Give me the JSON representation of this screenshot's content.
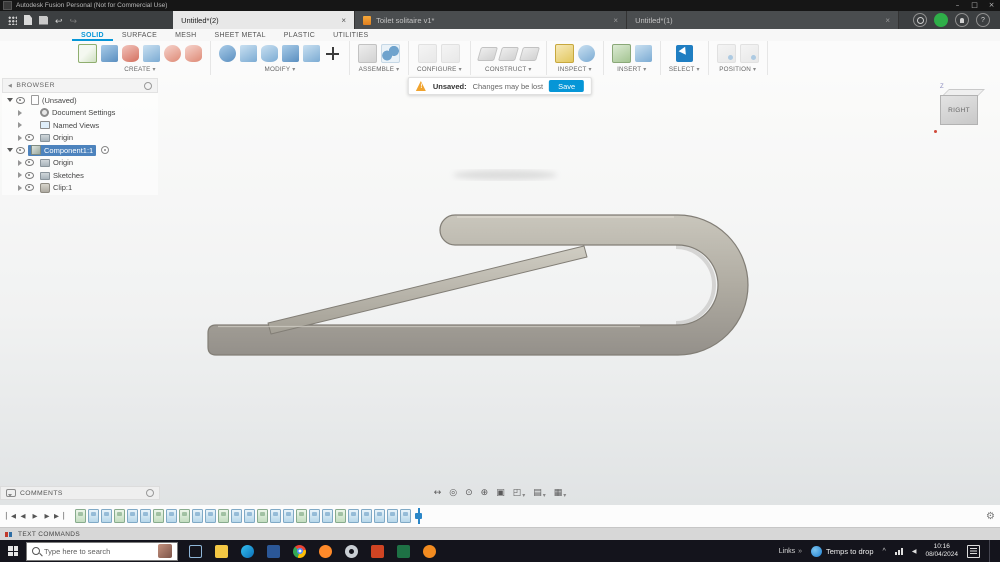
{
  "window": {
    "title": "Autodesk Fusion Personal (Not for Commercial Use)",
    "minimize": "–",
    "maximize": "□",
    "close": "×"
  },
  "doc_tabs": [
    {
      "label": "Untitled*(2)",
      "close": "×",
      "active": true
    },
    {
      "label": "Toilet solitaire v1*",
      "close": "×",
      "icon": true
    },
    {
      "label": "Untitled*(1)",
      "close": "×"
    }
  ],
  "ribbon": {
    "tabs": [
      {
        "label": "SOLID",
        "active": true
      },
      {
        "label": "SURFACE"
      },
      {
        "label": "MESH"
      },
      {
        "label": "SHEET METAL"
      },
      {
        "label": "PLASTIC"
      },
      {
        "label": "UTILITIES"
      }
    ],
    "groups": [
      {
        "label": "CREATE"
      },
      {
        "label": "MODIFY"
      },
      {
        "label": "ASSEMBLE"
      },
      {
        "label": "CONFIGURE"
      },
      {
        "label": "CONSTRUCT"
      },
      {
        "label": "INSPECT"
      },
      {
        "label": "INSERT"
      },
      {
        "label": "SELECT"
      },
      {
        "label": "POSITION"
      }
    ]
  },
  "notification": {
    "title": "Unsaved:",
    "message": "Changes may be lost",
    "action": "Save"
  },
  "browser": {
    "header": "BROWSER",
    "items": [
      {
        "label": "(Unsaved)",
        "level": 0,
        "type": "doc",
        "expanded": true,
        "eye": true
      },
      {
        "label": "Document Settings",
        "level": 1,
        "type": "gear"
      },
      {
        "label": "Named Views",
        "level": 1,
        "type": "views"
      },
      {
        "label": "Origin",
        "level": 1,
        "type": "folder",
        "eye": true
      },
      {
        "label": "Component1:1",
        "level": 0,
        "type": "component",
        "expanded": true,
        "eye": true,
        "selected": true,
        "radio": true
      },
      {
        "label": "Origin",
        "level": 1,
        "type": "folder",
        "eye": true
      },
      {
        "label": "Sketches",
        "level": 1,
        "type": "folder",
        "eye": true
      },
      {
        "label": "Clip:1",
        "level": 1,
        "type": "body",
        "eye": true
      }
    ]
  },
  "viewcube": {
    "face": "RIGHT",
    "axis": "Z"
  },
  "comments": {
    "label": "COMMENTS"
  },
  "navbar": {
    "items": [
      {
        "name": "pan-icon"
      },
      {
        "name": "orbit-icon"
      },
      {
        "name": "look-at-icon"
      },
      {
        "name": "zoom-icon"
      },
      {
        "name": "fit-icon"
      },
      {
        "name": "zoom-window-icon",
        "caret": true
      },
      {
        "name": "display-settings-icon",
        "caret": true
      },
      {
        "name": "grid-display-icon",
        "caret": true
      }
    ]
  },
  "timeline": {
    "features": [
      {
        "type": "sketch"
      },
      {
        "type": "feature"
      },
      {
        "type": "feature"
      },
      {
        "type": "sketch"
      },
      {
        "type": "feature"
      },
      {
        "type": "feature"
      },
      {
        "type": "sketch"
      },
      {
        "type": "feature"
      },
      {
        "type": "sketch"
      },
      {
        "type": "feature"
      },
      {
        "type": "feature"
      },
      {
        "type": "sketch"
      },
      {
        "type": "feature"
      },
      {
        "type": "feature"
      },
      {
        "type": "sketch"
      },
      {
        "type": "feature"
      },
      {
        "type": "feature"
      },
      {
        "type": "sketch"
      },
      {
        "type": "feature"
      },
      {
        "type": "feature"
      },
      {
        "type": "sketch"
      },
      {
        "type": "feature"
      },
      {
        "type": "feature"
      },
      {
        "type": "feature"
      },
      {
        "type": "feature"
      },
      {
        "type": "feature"
      }
    ]
  },
  "text_commands": {
    "label": "TEXT COMMANDS"
  },
  "taskbar": {
    "search_placeholder": "Type here to search",
    "apps": [
      {
        "name": "task-view-icon",
        "color": "#7fb4e0"
      },
      {
        "name": "file-explorer-icon",
        "color": "#f3c744"
      },
      {
        "name": "edge-icon",
        "color": "#2f9ae0",
        "round": true
      },
      {
        "name": "word-icon",
        "color": "#2b5797"
      },
      {
        "name": "chrome-icon",
        "color": "#e8eaed",
        "round": true
      },
      {
        "name": "firefox-icon",
        "color": "#ff8a2a",
        "round": true
      },
      {
        "name": "settings-icon",
        "color": "#c9ced4",
        "round": true
      },
      {
        "name": "powerpoint-icon",
        "color": "#d04423"
      },
      {
        "name": "excel-icon",
        "color": "#1e7145"
      },
      {
        "name": "fusion-360-icon",
        "color": "#f28b20",
        "round": true
      }
    ],
    "tray": {
      "links": "Links",
      "weather": "Temps to drop",
      "time": "10:16",
      "date": "08/04/2024"
    }
  },
  "icons": {
    "quick_access": [
      "application-menu-icon",
      "file-menu-icon",
      "save-icon",
      "undo-icon",
      "redo-icon"
    ],
    "account": [
      "job-status-icon",
      "user-avatar",
      "notifications-icon",
      "help-icon"
    ],
    "create_group": [
      "create-sketch-icon",
      "box-icon",
      "cylinder-icon",
      "extrude-icon",
      "revolve-icon",
      "coil-icon"
    ],
    "modify_group": [
      "press-pull-icon",
      "fillet-icon",
      "shell-icon",
      "combine-icon",
      "offset-face-icon",
      "move-copy-icon"
    ],
    "assemble_group": [
      "new-component-icon",
      "joint-icon"
    ],
    "configure_group": [
      "configuration-icon",
      "configuration-table-icon"
    ],
    "construct_group": [
      "offset-plane-icon",
      "axis-icon",
      "point-icon"
    ],
    "inspect_group": [
      "measure-icon",
      "section-analysis-icon"
    ],
    "insert_group": [
      "insert-mesh-icon",
      "decal-icon"
    ],
    "select_group": [
      "select-icon"
    ],
    "position_group": [
      "capture-position-icon",
      "revert-position-icon"
    ],
    "playback": [
      "go-to-start-icon",
      "step-back-icon",
      "play-icon",
      "step-forward-icon",
      "go-to-end-icon"
    ],
    "tray": [
      "hidden-icons-chevron",
      "network-icon",
      "volume-icon",
      "action-center-icon"
    ]
  },
  "colors": {
    "accent": "#0696d7",
    "selection": "#4d83bd",
    "warning": "#f0a32e",
    "model_gray": "#aaa69c"
  }
}
